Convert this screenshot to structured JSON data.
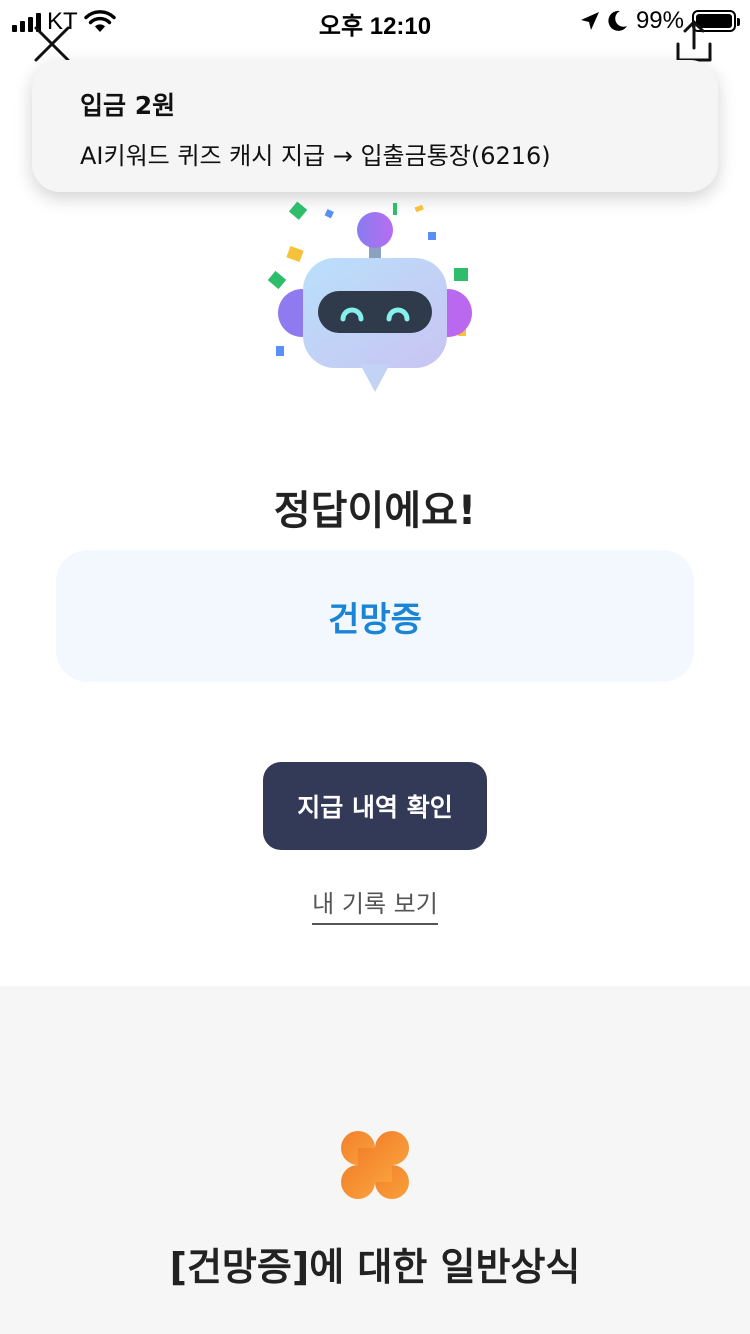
{
  "status_bar": {
    "carrier": "KT",
    "time": "오후 12:10",
    "battery": "99%"
  },
  "notification": {
    "title": "입금 2원",
    "body": "AI키워드 퀴즈 캐시 지급 → 입출금통장(6216)"
  },
  "result": {
    "title": "정답이에요!",
    "answer": "건망증"
  },
  "actions": {
    "primary_label": "지급 내역 확인",
    "secondary_label": "내 기록 보기"
  },
  "knowledge": {
    "title": "[건망증]에 대한 일반상식"
  },
  "icons": {
    "close": "close-icon",
    "share": "share-icon",
    "mascot": "robot-mascot",
    "clover": "clover-icon"
  },
  "colors": {
    "answer_text": "#1a85d6",
    "answer_bg": "#f2f8fe",
    "primary_button": "#333a58",
    "clover": "#f58a2e"
  }
}
